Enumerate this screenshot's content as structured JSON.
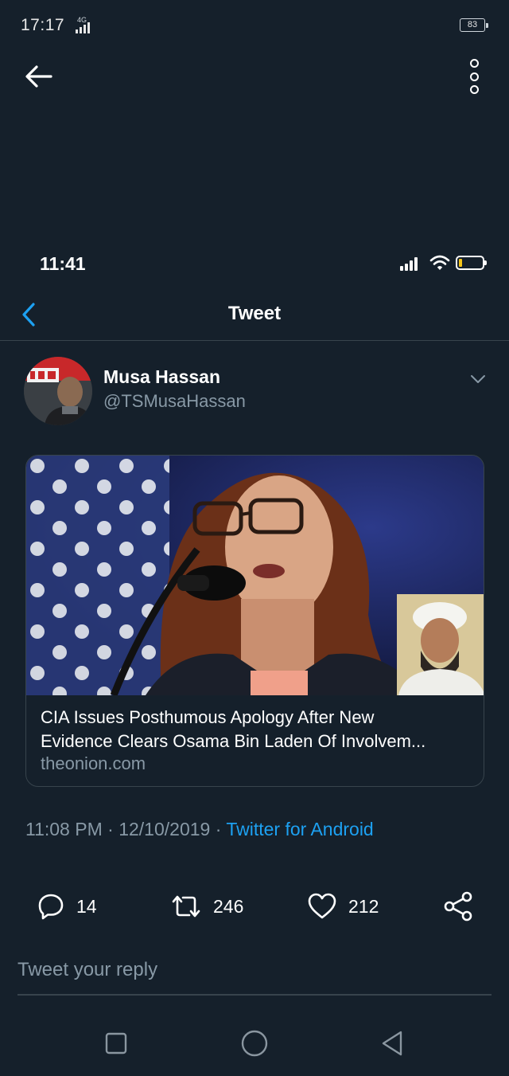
{
  "outer_status": {
    "time": "17:17",
    "network_label": "4G",
    "battery_level": "83"
  },
  "ios_status": {
    "time": "11:41"
  },
  "nav": {
    "title": "Tweet"
  },
  "tweet": {
    "author_name": "Musa Hassan",
    "author_handle": "@TSMusaHassan",
    "card": {
      "title_line1": "CIA Issues Posthumous Apology After New",
      "title_line2": "Evidence Clears Osama Bin Laden Of Involvem...",
      "domain": "theonion.com"
    },
    "time": "11:08 PM",
    "separator": " · ",
    "date": "12/10/2019",
    "source": "Twitter for Android"
  },
  "actions": {
    "replies": "14",
    "retweets": "246",
    "likes": "212"
  },
  "reply": {
    "placeholder": "Tweet your reply"
  },
  "icons": {
    "back": "arrow-left-icon",
    "more": "more-vertical-icon",
    "reply": "speech-bubble-icon",
    "retweet": "retweet-icon",
    "like": "heart-icon",
    "share": "share-icon"
  },
  "colors": {
    "background": "#15202b",
    "accent": "#1da1f2",
    "muted_text": "#8899a6",
    "divider": "#38444d"
  }
}
